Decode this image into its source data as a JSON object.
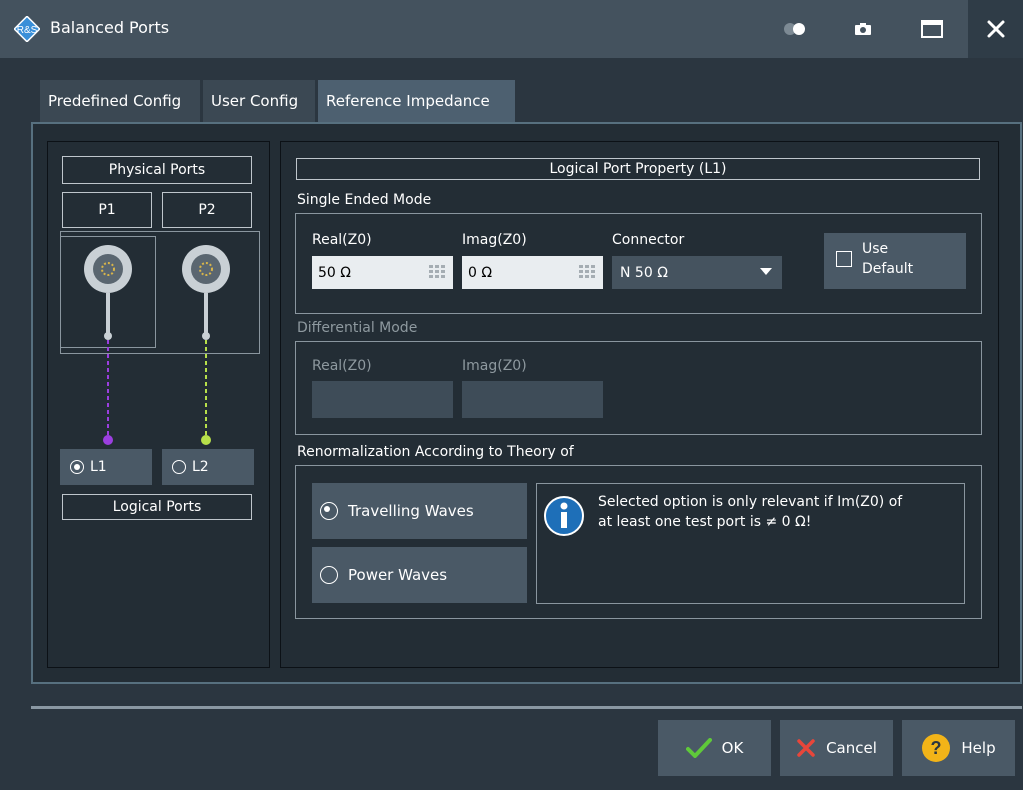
{
  "window": {
    "title": "Balanced Ports"
  },
  "tabs": [
    {
      "label": "Predefined Config",
      "active": false
    },
    {
      "label": "User Config",
      "active": false
    },
    {
      "label": "Reference Impedance",
      "active": true
    }
  ],
  "physical_ports": {
    "title": "Physical Ports",
    "ports": [
      "P1",
      "P2"
    ],
    "trace_colors": [
      "#9b3fe0",
      "#b7e04a"
    ]
  },
  "logical_ports": {
    "title": "Logical Ports",
    "ports": [
      {
        "label": "L1",
        "selected": true
      },
      {
        "label": "L2",
        "selected": false
      }
    ]
  },
  "property": {
    "title": "Logical Port Property (L1)",
    "single_ended": {
      "title": "Single Ended Mode",
      "real_label": "Real(Z0)",
      "real_value": "50 Ω",
      "imag_label": "Imag(Z0)",
      "imag_value": "0 Ω",
      "connector_label": "Connector",
      "connector_value": "N 50 Ω",
      "use_default_label_1": "Use",
      "use_default_label_2": "Default",
      "use_default_checked": false
    },
    "differential": {
      "title": "Differential Mode",
      "real_label": "Real(Z0)",
      "imag_label": "Imag(Z0)",
      "enabled": false
    },
    "renormalization": {
      "title": "Renormalization According to Theory of",
      "options": [
        {
          "label": "Travelling Waves",
          "selected": true
        },
        {
          "label": "Power Waves",
          "selected": false
        }
      ],
      "info_line_1": "Selected option is only relevant if Im(Z0) of",
      "info_line_2": "at least one test port is ≠ 0 Ω!"
    }
  },
  "footer": {
    "ok_label": "OK",
    "cancel_label": "Cancel",
    "help_label": "Help"
  },
  "colors": {
    "accent_blue": "#1e6fb8",
    "ok_green": "#5fc93a",
    "cancel_red": "#e8463a",
    "help_yellow": "#f2b418"
  }
}
